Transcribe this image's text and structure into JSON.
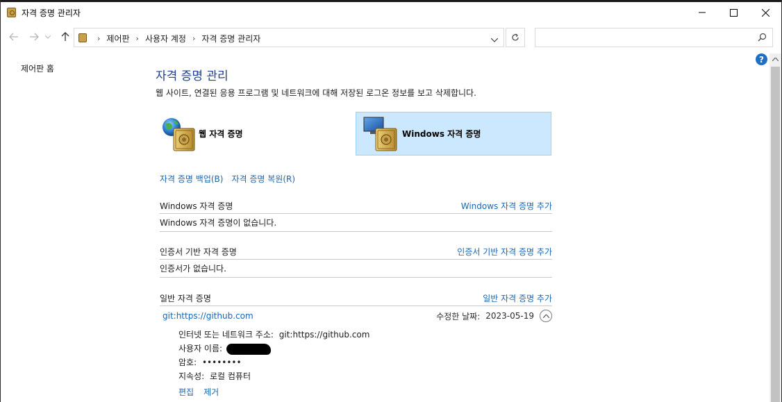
{
  "window": {
    "title": "자격 증명 관리자"
  },
  "address": {
    "crumbs": [
      "제어판",
      "사용자 계정",
      "자격 증명 관리자"
    ]
  },
  "search": {
    "placeholder": ""
  },
  "left_pane": {
    "home_link": "제어판 홈"
  },
  "help": {
    "label": "?"
  },
  "main": {
    "heading": "자격 증명 관리",
    "subtitle": "웹 사이트, 연결된 응용 프로그램 및 네트워크에 대해 저장된 로그온 정보를 보고 삭제합니다.",
    "tiles": {
      "web": "웹 자격 증명",
      "windows": "Windows 자격 증명"
    },
    "backup_link": "자격 증명 백업(B)",
    "restore_link": "자격 증명 복원(R)",
    "sections": {
      "windows": {
        "title": "Windows 자격 증명",
        "add": "Windows 자격 증명 추가",
        "empty": "Windows 자격 증명이 없습니다."
      },
      "certificate": {
        "title": "인증서 기반 자격 증명",
        "add": "인증서 기반 자격 증명 추가",
        "empty": "인증서가 없습니다."
      },
      "generic": {
        "title": "일반 자격 증명",
        "add": "일반 자격 증명 추가"
      }
    },
    "entry": {
      "name": "git:https://github.com",
      "modified_label": "수정한 날짜:",
      "modified_date": "2023-05-19",
      "address_label": "인터넷 또는 네트워크 주소:",
      "address_value": "git:https://github.com",
      "username_label": "사용자 이름:",
      "password_label": "암호:",
      "password_value": "••••••••",
      "persistence_label": "지속성:",
      "persistence_value": "로컬 컴퓨터",
      "edit": "편집",
      "remove": "제거"
    }
  },
  "colors": {
    "heading": "#1e3f8f",
    "link": "#1a66b3",
    "selected_tile": "#cce8ff",
    "selected_tile_border": "#99d1ff"
  }
}
